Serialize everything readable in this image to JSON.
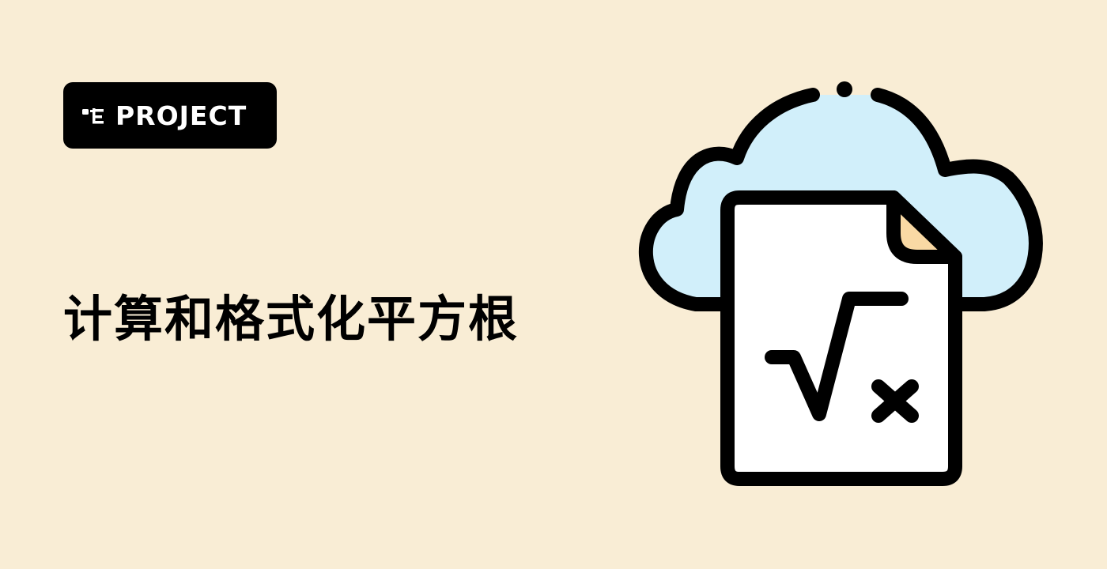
{
  "badge": {
    "label": "PROJECT",
    "icon": "project-tree-icon"
  },
  "title": "计算和格式化平方根",
  "illustration": {
    "icon": "cloud-math-document-icon",
    "symbol": "√x"
  },
  "colors": {
    "background": "#F9EDD5",
    "badge_background": "#000000",
    "badge_text": "#FFFFFF",
    "cloud_fill": "#D1EFFA",
    "document_fill": "#FFFFFF",
    "fold_fill": "#F9D9A4",
    "outline": "#000000"
  }
}
